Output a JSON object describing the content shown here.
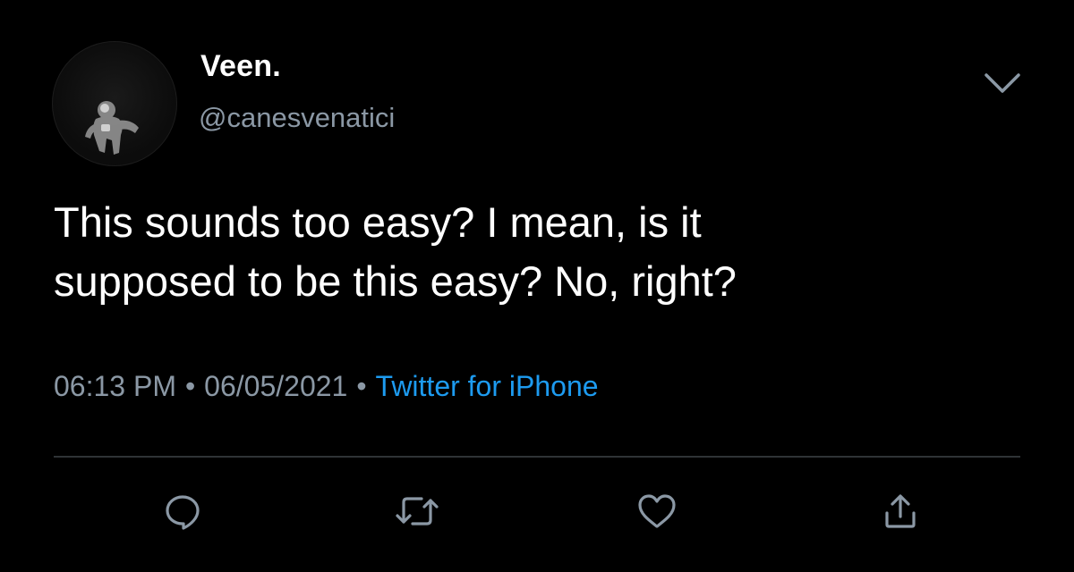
{
  "author": {
    "display_name": "Veen.",
    "handle": "@canesvenatici",
    "avatar_icon": "astronaut-avatar"
  },
  "tweet": {
    "text_lines": [
      "This sounds too easy? I mean, is it",
      "supposed to be this easy? No, right?"
    ],
    "time": "06:13 PM",
    "date": "06/05/2021",
    "separator": "•",
    "source": "Twitter for iPhone"
  },
  "actions": [
    {
      "icon": "reply-icon"
    },
    {
      "icon": "retweet-icon"
    },
    {
      "icon": "like-icon"
    },
    {
      "icon": "share-icon"
    }
  ],
  "colors": {
    "background": "#000000",
    "text_primary": "#ffffff",
    "text_secondary": "#8b98a5",
    "link": "#1d9bf0",
    "divider": "#2f3336",
    "icon": "#8b98a5"
  }
}
